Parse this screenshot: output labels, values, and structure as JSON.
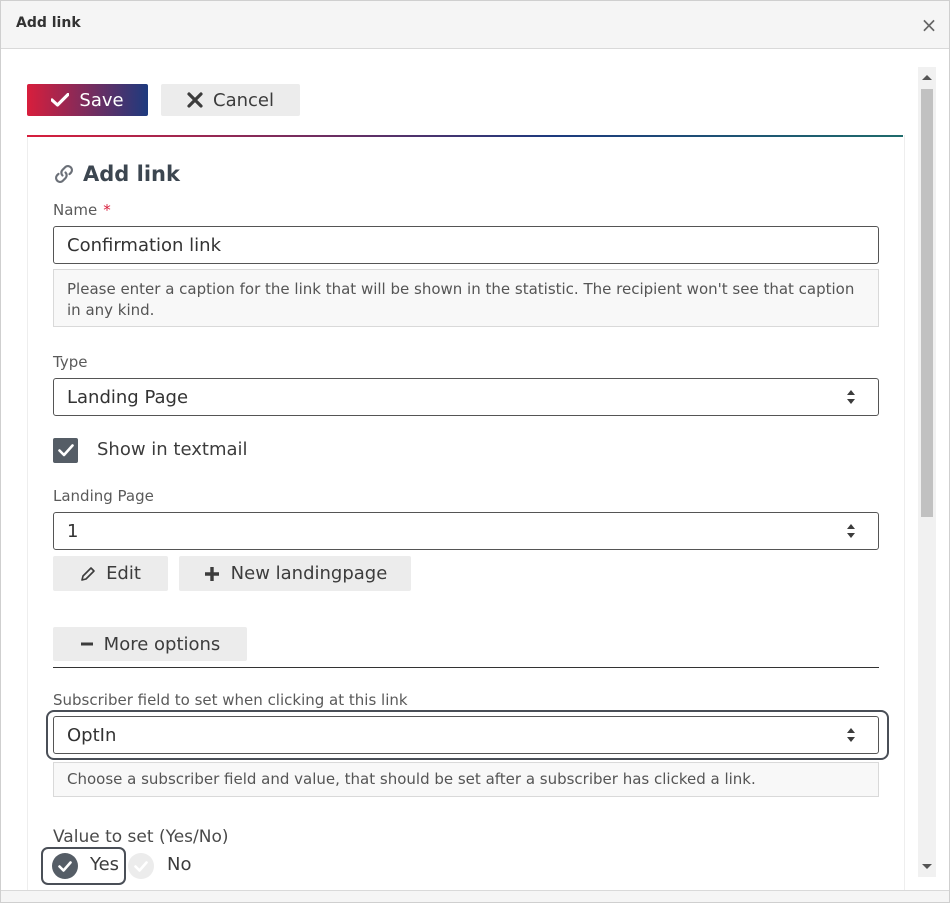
{
  "dialog": {
    "title": "Add link",
    "close_label": "×"
  },
  "toolbar": {
    "save_label": "Save",
    "cancel_label": "Cancel"
  },
  "form": {
    "heading": "Add link",
    "name": {
      "label": "Name",
      "required_mark": "*",
      "value": "Confirmation link",
      "help": "Please enter a caption for the link that will be shown in the statistic. The recipient won't see that caption in any kind."
    },
    "type": {
      "label": "Type",
      "value": "Landing Page"
    },
    "show_in_textmail": {
      "label": "Show in textmail",
      "checked": true
    },
    "landing_page": {
      "label": "Landing Page",
      "value": "1"
    },
    "edit_label": "Edit",
    "new_landingpage_label": "New landingpage",
    "more_options_label": "More options",
    "subscriber_field": {
      "label": "Subscriber field to set when clicking at this link",
      "value": "OptIn",
      "help": "Choose a subscriber field and value, that should be set after a subscriber has clicked a link."
    },
    "value_to_set": {
      "label": "Value to set (Yes/No)",
      "options": [
        "Yes",
        "No"
      ],
      "selected": "Yes"
    }
  },
  "colors": {
    "accent_start": "#d81e3c",
    "accent_end": "#1d3a7e",
    "required": "#d81e3c"
  }
}
